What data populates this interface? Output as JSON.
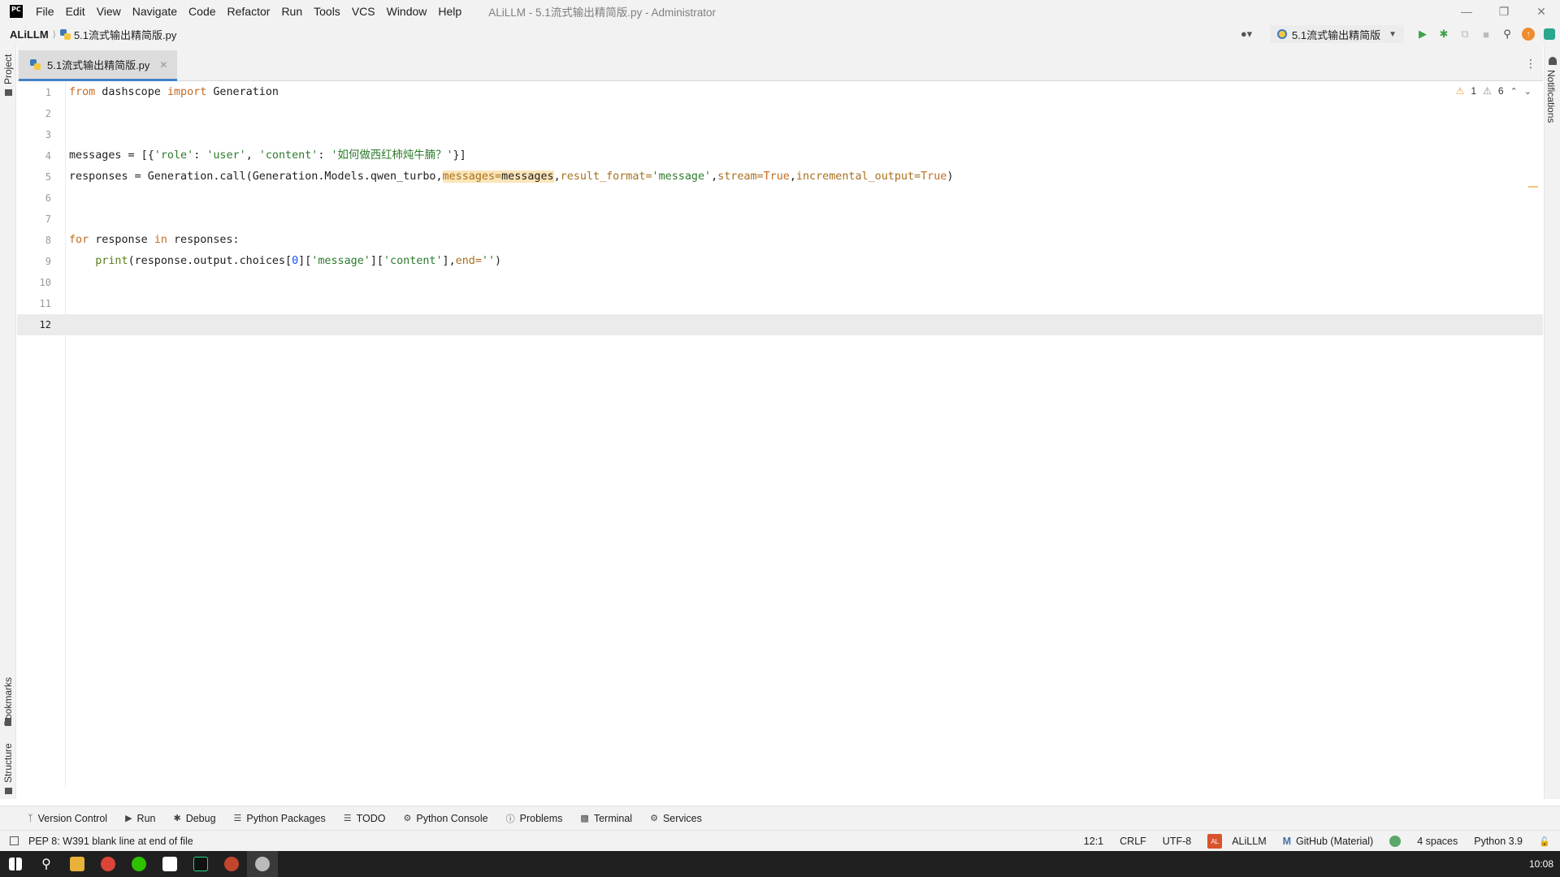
{
  "titlebar": {
    "logo": "PC",
    "menu": [
      "File",
      "Edit",
      "View",
      "Navigate",
      "Code",
      "Refactor",
      "Run",
      "Tools",
      "VCS",
      "Window",
      "Help"
    ],
    "window_title": "ALiLLM - 5.1流式输出精简版.py - Administrator"
  },
  "navbar": {
    "project": "ALiLLM",
    "file": "5.1流式输出精简版.py",
    "run_config": "5.1流式输出精简版"
  },
  "left_strip": {
    "project": "Project",
    "bookmarks": "Bookmarks",
    "structure": "Structure"
  },
  "right_strip": {
    "notifications": "Notifications"
  },
  "tab": {
    "label": "5.1流式输出精简版.py"
  },
  "inspections": {
    "warnings": "1",
    "weak_warnings": "6"
  },
  "editor": {
    "current_line": 12,
    "lines": [
      {
        "n": "1"
      },
      {
        "n": "2"
      },
      {
        "n": "3"
      },
      {
        "n": "4"
      },
      {
        "n": "5"
      },
      {
        "n": "6"
      },
      {
        "n": "7"
      },
      {
        "n": "8"
      },
      {
        "n": "9"
      },
      {
        "n": "10"
      },
      {
        "n": "11"
      },
      {
        "n": "12"
      }
    ],
    "code": {
      "l1_from": "from",
      "l1_mod": " dashscope ",
      "l1_import": "import",
      "l1_name": " Generation",
      "l4_a": "messages = [{",
      "l4_s1": "'role'",
      "l4_b": ": ",
      "l4_s2": "'user'",
      "l4_c": ", ",
      "l4_s3": "'content'",
      "l4_d": ": ",
      "l4_s4": "'如何做西红柿炖牛腩？'",
      "l4_e": "}]",
      "l5_a": "responses = Generation.call(Generation.Models.qwen_turbo,",
      "l5_hl_param": "messages=",
      "l5_hl_val": "messages",
      "l5_b": ",",
      "l5_p1": "result_format=",
      "l5_s1": "'message'",
      "l5_c": ",",
      "l5_p2": "stream=",
      "l5_v2": "True",
      "l5_d": ",",
      "l5_p3": "incremental_output=",
      "l5_v3": "True",
      "l5_e": ")",
      "l8_for": "for",
      "l8_a": " response ",
      "l8_in": "in",
      "l8_b": " responses:",
      "l9_indent": "    ",
      "l9_print": "print",
      "l9_a": "(response.output.choices[",
      "l9_num": "0",
      "l9_b": "][",
      "l9_s1": "'message'",
      "l9_c": "][",
      "l9_s2": "'content'",
      "l9_d": "],",
      "l9_p": "end=",
      "l9_s3": "''",
      "l9_e": ")"
    }
  },
  "bottom_tools": [
    "Version Control",
    "Run",
    "Debug",
    "Python Packages",
    "TODO",
    "Python Console",
    "Problems",
    "Terminal",
    "Services"
  ],
  "status": {
    "message": "PEP 8: W391 blank line at end of file",
    "position": "12:1",
    "line_sep": "CRLF",
    "encoding": "UTF-8",
    "project": "ALiLLM",
    "theme": "GitHub (Material)",
    "indent": "4 spaces",
    "interpreter": "Python 3.9"
  },
  "taskbar": {
    "clock": "10:08"
  }
}
